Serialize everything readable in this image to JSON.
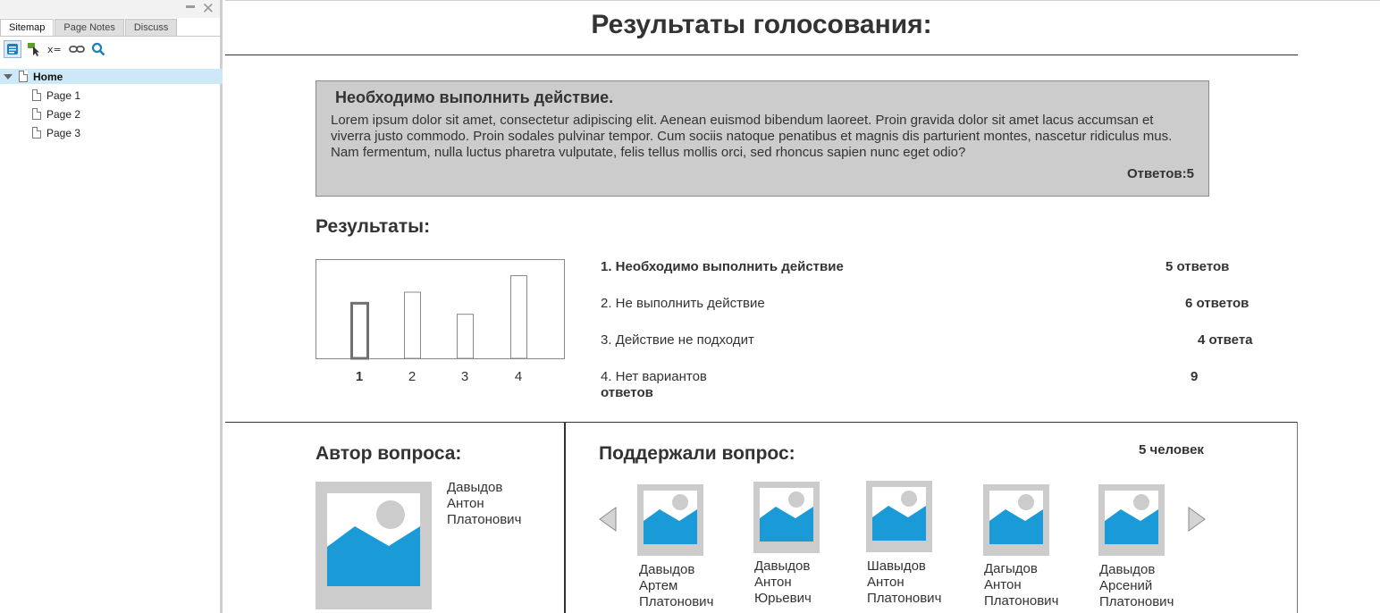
{
  "sidebar": {
    "tabs": [
      "Sitemap",
      "Page Notes",
      "Discuss"
    ],
    "tools": [
      "pages-icon",
      "add-page-icon",
      "variables-icon",
      "link-icon",
      "search-icon"
    ],
    "tree": {
      "home": "Home",
      "pages": [
        "Page 1",
        "Page 2",
        "Page 3"
      ]
    }
  },
  "page": {
    "title": "Результаты голосования:",
    "question": {
      "title": "Необходимо выполнить действие.",
      "text": "Lorem ipsum dolor sit amet, consectetur adipiscing elit. Aenean euismod bibendum laoreet. Proin gravida dolor sit amet lacus accumsan et viverra justo commodo. Proin sodales pulvinar tempor. Cum sociis natoque penatibus et magnis dis parturient montes, nascetur ridiculus mus. Nam fermentum, nulla luctus pharetra vulputate, felis tellus mollis orci, sed rhoncus sapien nunc eget odio?",
      "answers": "Ответов:5"
    },
    "results_heading": "Результаты:",
    "options": [
      {
        "label": "1. Необходимо выполнить действие",
        "count": "5 ответов"
      },
      {
        "label": "2. Не выполнить действие",
        "count": "6 ответов"
      },
      {
        "label": "3. Действие не подходит",
        "count": "4 ответа"
      },
      {
        "label": "4. Нет вариантов",
        "label_line2": "ответов",
        "count": "9"
      }
    ],
    "author": {
      "heading": "Автор вопроса:",
      "name_lines": [
        "Давыдов",
        "Антон",
        "Платонович"
      ]
    },
    "supporters": {
      "heading": "Поддержали вопрос:",
      "count": "5 человек",
      "people": [
        {
          "lines": [
            "Давыдов",
            "Артем",
            "Платонович"
          ]
        },
        {
          "lines": [
            "Давыдов",
            "Антон",
            "Юрьевич"
          ]
        },
        {
          "lines": [
            "Шавыдов",
            "Антон",
            "Платонович"
          ]
        },
        {
          "lines": [
            "Дагыдов",
            "Антон",
            "Платонович"
          ]
        },
        {
          "lines": [
            "Давыдов",
            "Арсений",
            "Платонович"
          ]
        }
      ]
    }
  },
  "chart_data": {
    "type": "bar",
    "categories": [
      "1",
      "2",
      "3",
      "4"
    ],
    "values": [
      5,
      6,
      4,
      7.5
    ],
    "title": "",
    "xlabel": "",
    "ylabel": "",
    "ylim": [
      0,
      9
    ],
    "grid": false,
    "highlighted_category": "1"
  },
  "colors": {
    "question_box_bg": "#cccccc",
    "selected_tree_row": "#cde8f6",
    "placeholder_blue": "#1a9bd7",
    "placeholder_frame": "#cccccc",
    "text": "#333333"
  }
}
